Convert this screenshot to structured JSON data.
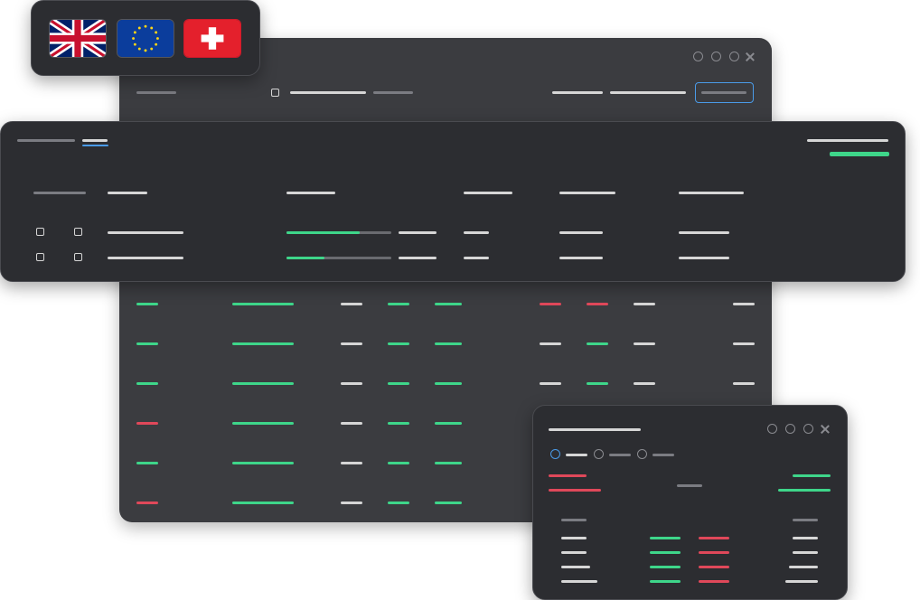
{
  "colors": {
    "back_window_bg": "#3b3c40",
    "front_window_bg": "#2c2d31",
    "text_placeholder": "#d6d6d6",
    "muted_placeholder": "#7b7c82",
    "positive": "#3ed68a",
    "negative": "#e0485a",
    "accent": "#4a9be8",
    "progress_track": "#6a6b70"
  },
  "flags": [
    {
      "name": "united-kingdom",
      "icon": "uk-flag-icon"
    },
    {
      "name": "european-union",
      "icon": "eu-flag-icon"
    },
    {
      "name": "switzerland",
      "icon": "swiss-flag-icon"
    }
  ],
  "window_controls": [
    "minimize-control",
    "maximize-control",
    "restore-control",
    "close-control"
  ],
  "mid_table": {
    "rows": [
      {
        "progress": 0.7
      },
      {
        "progress": 0.36
      }
    ]
  },
  "back_table": {
    "row_status": [
      "positive",
      "positive",
      "positive",
      "negative",
      "positive",
      "negative"
    ],
    "extra_columns": [
      [
        "negative",
        "negative"
      ],
      [
        "neutral",
        "positive"
      ],
      [
        "neutral",
        "positive"
      ]
    ]
  },
  "small_window": {
    "radio_selected_index": 0,
    "rows": 4
  }
}
